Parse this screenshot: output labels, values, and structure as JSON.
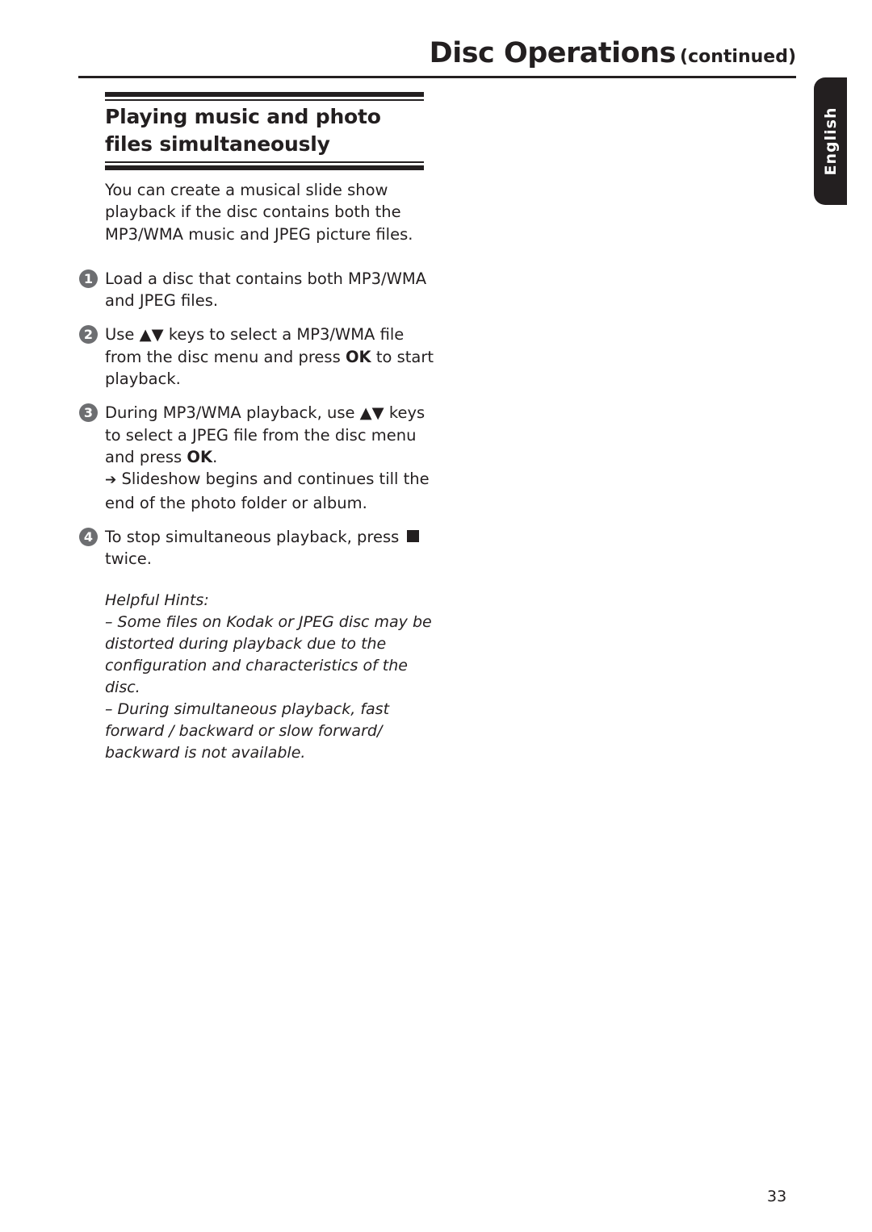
{
  "header": {
    "title": "Disc Operations",
    "subtitle": "(continued)"
  },
  "language_tab": "English",
  "section": {
    "title": "Playing music and photo files simultaneously"
  },
  "intro": "You can create a musical slide show playback if the disc contains both the MP3/WMA music and JPEG picture files.",
  "steps": [
    {
      "number": "1",
      "text": "Load a disc that contains both MP3/WMA and JPEG files."
    },
    {
      "number": "2",
      "pre": "Use ▲▼ keys to select a MP3/WMA file from the disc menu and press ",
      "bold": "OK",
      "post": " to start playback."
    },
    {
      "number": "3",
      "pre": "During MP3/WMA playback, use ▲▼ keys to select a JPEG file from the disc menu and press ",
      "bold": "OK",
      "post": ".",
      "result_arrow": "➔",
      "result": "Slideshow begins and continues till the end of the photo folder or album."
    },
    {
      "number": "4",
      "pre": "To stop simultaneous playback, press",
      "icon": "stop-icon",
      "post": "twice."
    }
  ],
  "hints": {
    "title": "Helpful Hints:",
    "items": [
      "–  Some files on Kodak or JPEG disc may be distorted during playback due to the configuration and characteristics of the disc.",
      "–  During simultaneous playback, fast forward / backward or slow forward/ backward is not available."
    ]
  },
  "page_number": "33"
}
